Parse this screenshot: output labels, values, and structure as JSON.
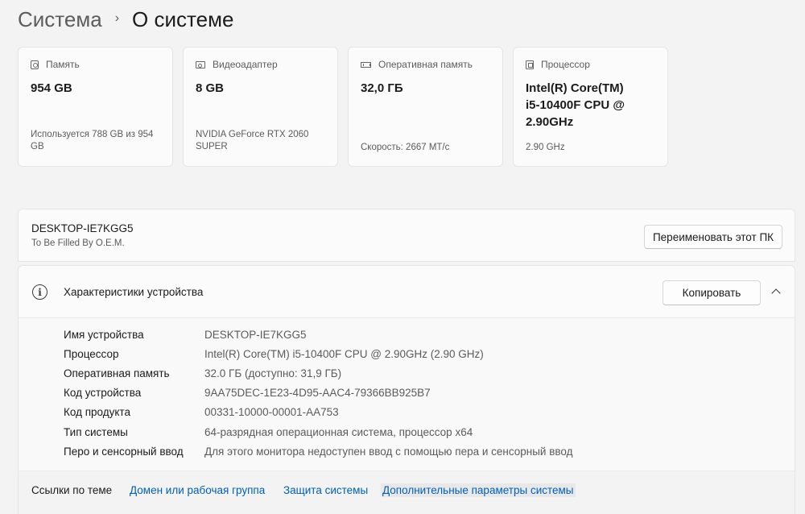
{
  "breadcrumb": {
    "parent": "Система",
    "separator": "›",
    "current": "О системе"
  },
  "specs": [
    {
      "icon": "storage-icon",
      "caption": "Память",
      "value": "954 GB",
      "sub": "Используется 788 GB из 954 GB"
    },
    {
      "icon": "gpu-icon",
      "caption": "Видеоадаптер",
      "value": "8 GB",
      "sub": "NVIDIA GeForce RTX 2060 SUPER"
    },
    {
      "icon": "ram-icon",
      "caption": "Оперативная память",
      "value": "32,0 ГБ",
      "sub": "Скорость: 2667 МТ/с"
    },
    {
      "icon": "cpu-icon",
      "caption": "Процессор",
      "value": "Intel(R) Core(TM) i5-10400F CPU @ 2.90GHz",
      "sub": "2.90 GHz"
    }
  ],
  "pc": {
    "name": "DESKTOP-IE7KGG5",
    "model": "To Be Filled By O.E.M.",
    "rename_label": "Переименовать этот ПК"
  },
  "device": {
    "title": "Характеристики устройства",
    "copy_label": "Копировать",
    "rows": [
      {
        "key": "Имя устройства",
        "value": "DESKTOP-IE7KGG5"
      },
      {
        "key": "Процессор",
        "value": "Intel(R) Core(TM) i5-10400F CPU @ 2.90GHz (2.90 GHz)"
      },
      {
        "key": "Оперативная память",
        "value": "32.0 ГБ (доступно: 31,9 ГБ)"
      },
      {
        "key": "Код устройства",
        "value": "9AA75DEC-1E23-4D95-AAC4-79366BB925B7"
      },
      {
        "key": "Код продукта",
        "value": "00331-10000-00001-AA753"
      },
      {
        "key": "Тип системы",
        "value": "64-разрядная операционная система, процессор x64"
      },
      {
        "key": "Перо и сенсорный ввод",
        "value": "Для этого монитора недоступен ввод с помощью пера и сенсорный ввод"
      }
    ]
  },
  "related": {
    "title": "Ссылки по теме",
    "links": [
      "Домен или рабочая группа",
      "Защита системы",
      "Дополнительные параметры системы"
    ]
  },
  "colors": {
    "link": "#005fb8",
    "background": "#f3f3f3",
    "card": "#fbfbfb"
  }
}
